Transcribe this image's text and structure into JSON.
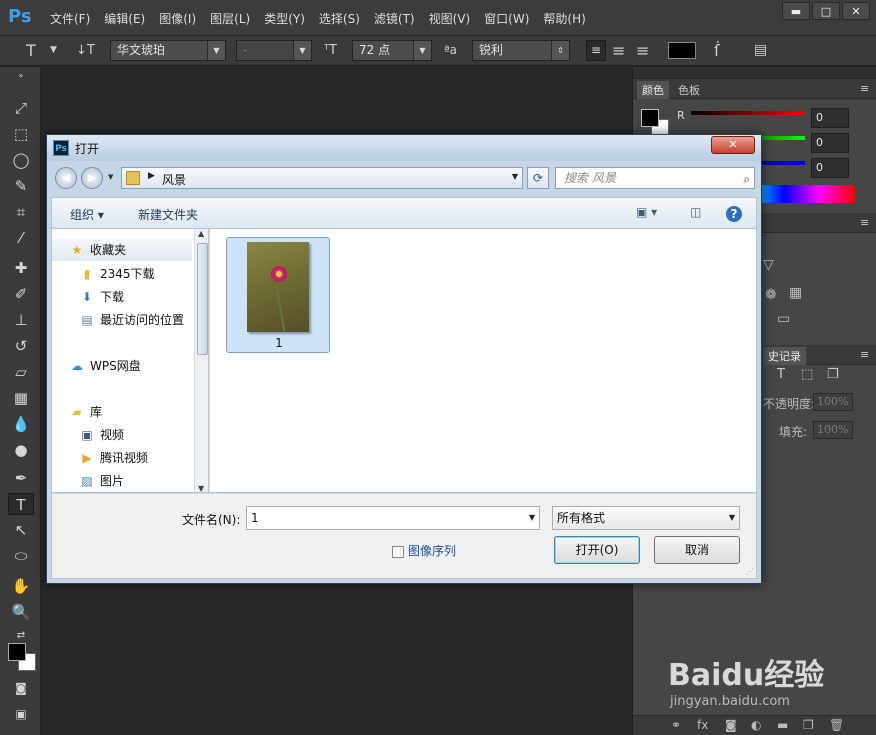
{
  "app": {
    "logo": "Ps",
    "menus": [
      "文件(F)",
      "编辑(E)",
      "图像(I)",
      "图层(L)",
      "类型(Y)",
      "选择(S)",
      "滤镜(T)",
      "视图(V)",
      "窗口(W)",
      "帮助(H)"
    ],
    "window_controls": {
      "minimize": "▬",
      "maximize": "□",
      "close": "✕"
    }
  },
  "options": {
    "tool_glyph": "T",
    "font_family": "华文琥珀",
    "font_style": "-",
    "font_size": "72 点",
    "aa_label": "ªa",
    "aa_mode": "锐利",
    "color_swatch": "#000000"
  },
  "panels": {
    "color_tab": "颜色",
    "swatches_tab": "色板",
    "r_label": "R",
    "r_value": "0",
    "g_value": "0",
    "b_value": "0",
    "history_tab": "史记录",
    "opacity_label": "不透明度:",
    "opacity_value": "100%",
    "fill_label": "填充:",
    "fill_value": "100%"
  },
  "dialog": {
    "title": "打开",
    "close": "✕",
    "breadcrumb": "风景",
    "search_placeholder": "搜索 风景",
    "organize": "组织 ▾",
    "new_folder": "新建文件夹",
    "nav": {
      "favorites": "收藏夹",
      "downloads_2345": "2345下载",
      "downloads": "下载",
      "recent": "最近访问的位置",
      "wps": "WPS网盘",
      "library": "库",
      "videos": "视频",
      "tencent_video": "腾讯视频",
      "pictures": "图片"
    },
    "file": {
      "name": "1"
    },
    "filename_label": "文件名(N):",
    "filename_value": "1",
    "filetype_value": "所有格式",
    "image_sequence": "图像序列",
    "open_button": "打开(O)",
    "cancel_button": "取消"
  },
  "watermark": {
    "brand": "Baidu经验",
    "url": "jingyan.baidu.com"
  }
}
